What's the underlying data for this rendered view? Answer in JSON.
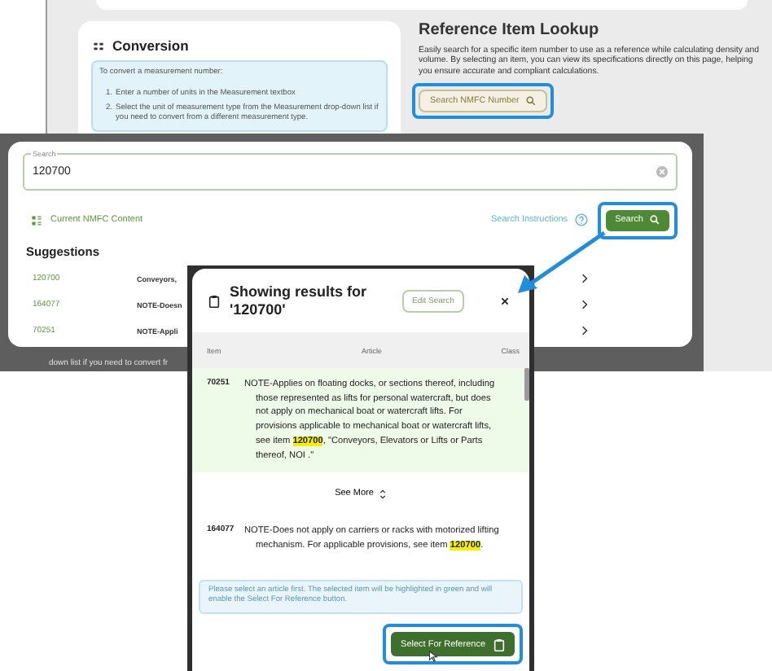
{
  "reference_page": {
    "conversion": {
      "title": "Conversion",
      "intro": "To convert a measurement number:",
      "steps": [
        {
          "number": "1.",
          "text": "Enter a number of units in the Measurement textbox"
        },
        {
          "number": "2.",
          "text": "Select the unit of measurement type from the Measurement drop-down list if you need to convert from a different measurement type."
        }
      ]
    },
    "lookup": {
      "title": "Reference Item Lookup",
      "description": "Easily search for a specific item number to use as a reference while calculating density and volume. By selecting an item, you can view its specifications directly on this page, helping you ensure accurate and compliant calculations.",
      "search_button": "Search NMFC Number"
    },
    "underlay_text": "down list if you need to convert fr"
  },
  "search_dialog": {
    "search_field": {
      "label": "Search",
      "value": "120700"
    },
    "content_link": "Current NMFC Content",
    "instructions_link": "Search Instructions",
    "search_button": "Search",
    "suggestions_title": "Suggestions",
    "suggestions": [
      {
        "item": "120700",
        "text": "Conveyors,"
      },
      {
        "item": "164077",
        "text": "NOTE-Doesn"
      },
      {
        "item": "70251",
        "text": "NOTE-Appli"
      }
    ]
  },
  "results_dialog": {
    "title": "Showing results for",
    "query": "'120700'",
    "edit_button": "Edit Search",
    "columns": [
      "Item",
      "Article",
      "Class"
    ],
    "rows": [
      {
        "item": "70251",
        "article": "NOTE-Applies on floating docks, or sections thereof, including those represented as lifts for personal watercraft, but does not apply on mechanical boat or watercraft lifts. For provisions applicable to mechanical boat or watercraft lifts, see item **120700**, \"Conveyors, Elevators or Lifts or Parts thereof, NOI .\"",
        "selected": true
      },
      {
        "item": "164077",
        "article": "NOTE-Does not apply on carriers or racks with motorized lifting mechanism. For applicable provisions, see item **120700**.",
        "selected": false
      }
    ],
    "see_more": "See More",
    "info": "Please select an article first. The selected item will be highlighted in green and will enable the Select For Reference button.",
    "select_button": "Select For Reference"
  }
}
